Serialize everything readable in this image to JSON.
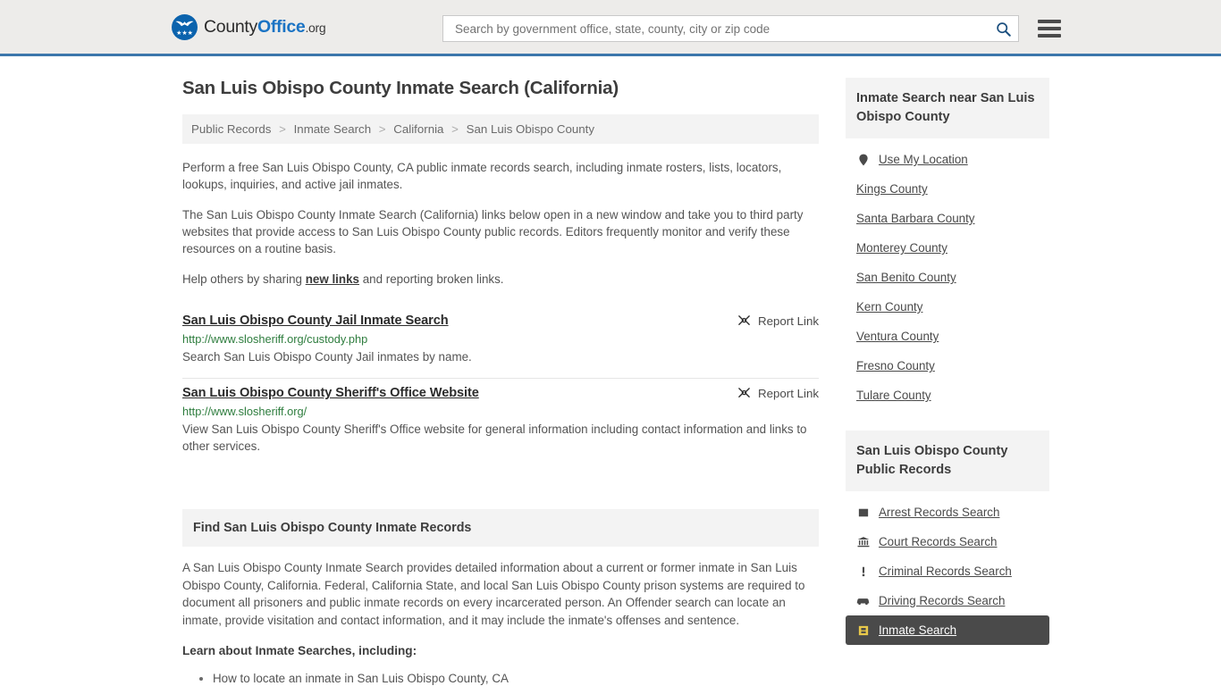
{
  "header": {
    "logo_text_county": "County",
    "logo_text_office": "Office",
    "logo_text_org": ".org",
    "logo_icon": "eagle-shield-logo",
    "search_placeholder": "Search by government office, state, county, city or zip code",
    "search_value": "",
    "search_icon": "search-icon",
    "menu_icon": "hamburger-menu-icon"
  },
  "page_title": "San Luis Obispo County Inmate Search (California)",
  "breadcrumb": {
    "separator": ">",
    "items": [
      {
        "label": "Public Records"
      },
      {
        "label": "Inmate Search"
      },
      {
        "label": "California"
      },
      {
        "label": "San Luis Obispo County"
      }
    ]
  },
  "intro": {
    "p1": "Perform a free San Luis Obispo County, CA public inmate records search, including inmate rosters, lists, locators, lookups, inquiries, and active jail inmates.",
    "p2": "The San Luis Obispo County Inmate Search (California) links below open in a new window and take you to third party websites that provide access to San Luis Obispo County public records. Editors frequently monitor and verify these resources on a routine basis.",
    "p3_before": "Help others by sharing ",
    "p3_link": "new links",
    "p3_after": " and reporting broken links."
  },
  "results": {
    "report_label": "Report Link",
    "report_icon": "broken-link-icon",
    "items": [
      {
        "title": "San Luis Obispo County Jail Inmate Search",
        "url": "http://www.slosheriff.org/custody.php",
        "description": "Search San Luis Obispo County Jail inmates by name."
      },
      {
        "title": "San Luis Obispo County Sheriff's Office Website",
        "url": "http://www.slosheriff.org/",
        "description": "View San Luis Obispo County Sheriff's Office website for general information including contact information and links to other services."
      }
    ]
  },
  "find_section": {
    "heading": "Find San Luis Obispo County Inmate Records",
    "paragraph": "A San Luis Obispo County Inmate Search provides detailed information about a current or former inmate in San Luis Obispo County, California. Federal, California State, and local San Luis Obispo County prison systems are required to document all prisoners and public inmate records on every incarcerated person. An Offender search can locate an inmate, provide visitation and contact information, and it may include the inmate's offenses and sentence.",
    "learn_heading": "Learn about Inmate Searches, including:",
    "bullets": [
      "How to locate an inmate in San Luis Obispo County, CA"
    ]
  },
  "sidebar": {
    "near_panel": {
      "title": "Inmate Search near San Luis Obispo County",
      "items": [
        {
          "label": "Use My Location",
          "icon": "map-pin-icon"
        },
        {
          "label": "Kings County",
          "icon": ""
        },
        {
          "label": "Santa Barbara County",
          "icon": ""
        },
        {
          "label": "Monterey County",
          "icon": ""
        },
        {
          "label": "San Benito County",
          "icon": ""
        },
        {
          "label": "Kern County",
          "icon": ""
        },
        {
          "label": "Ventura County",
          "icon": ""
        },
        {
          "label": "Fresno County",
          "icon": ""
        },
        {
          "label": "Tulare County",
          "icon": ""
        }
      ]
    },
    "records_panel": {
      "title": "San Luis Obispo County Public Records",
      "items": [
        {
          "label": "Arrest Records Search",
          "icon": "square-icon",
          "active": false
        },
        {
          "label": "Court Records Search",
          "icon": "courthouse-icon",
          "active": false
        },
        {
          "label": "Criminal Records Search",
          "icon": "exclamation-icon",
          "active": false
        },
        {
          "label": "Driving Records Search",
          "icon": "car-icon",
          "active": false
        },
        {
          "label": "Inmate Search",
          "icon": "id-card-icon",
          "active": true
        }
      ]
    }
  },
  "colors": {
    "header_bg": "#edecea",
    "header_border": "#3c77ab",
    "brand_blue": "#1a73c4",
    "url_green": "#2e7d3e",
    "panel_gray": "#f3f3f3",
    "active_dark": "#4a4a4a",
    "active_icon": "#e8c84a"
  }
}
